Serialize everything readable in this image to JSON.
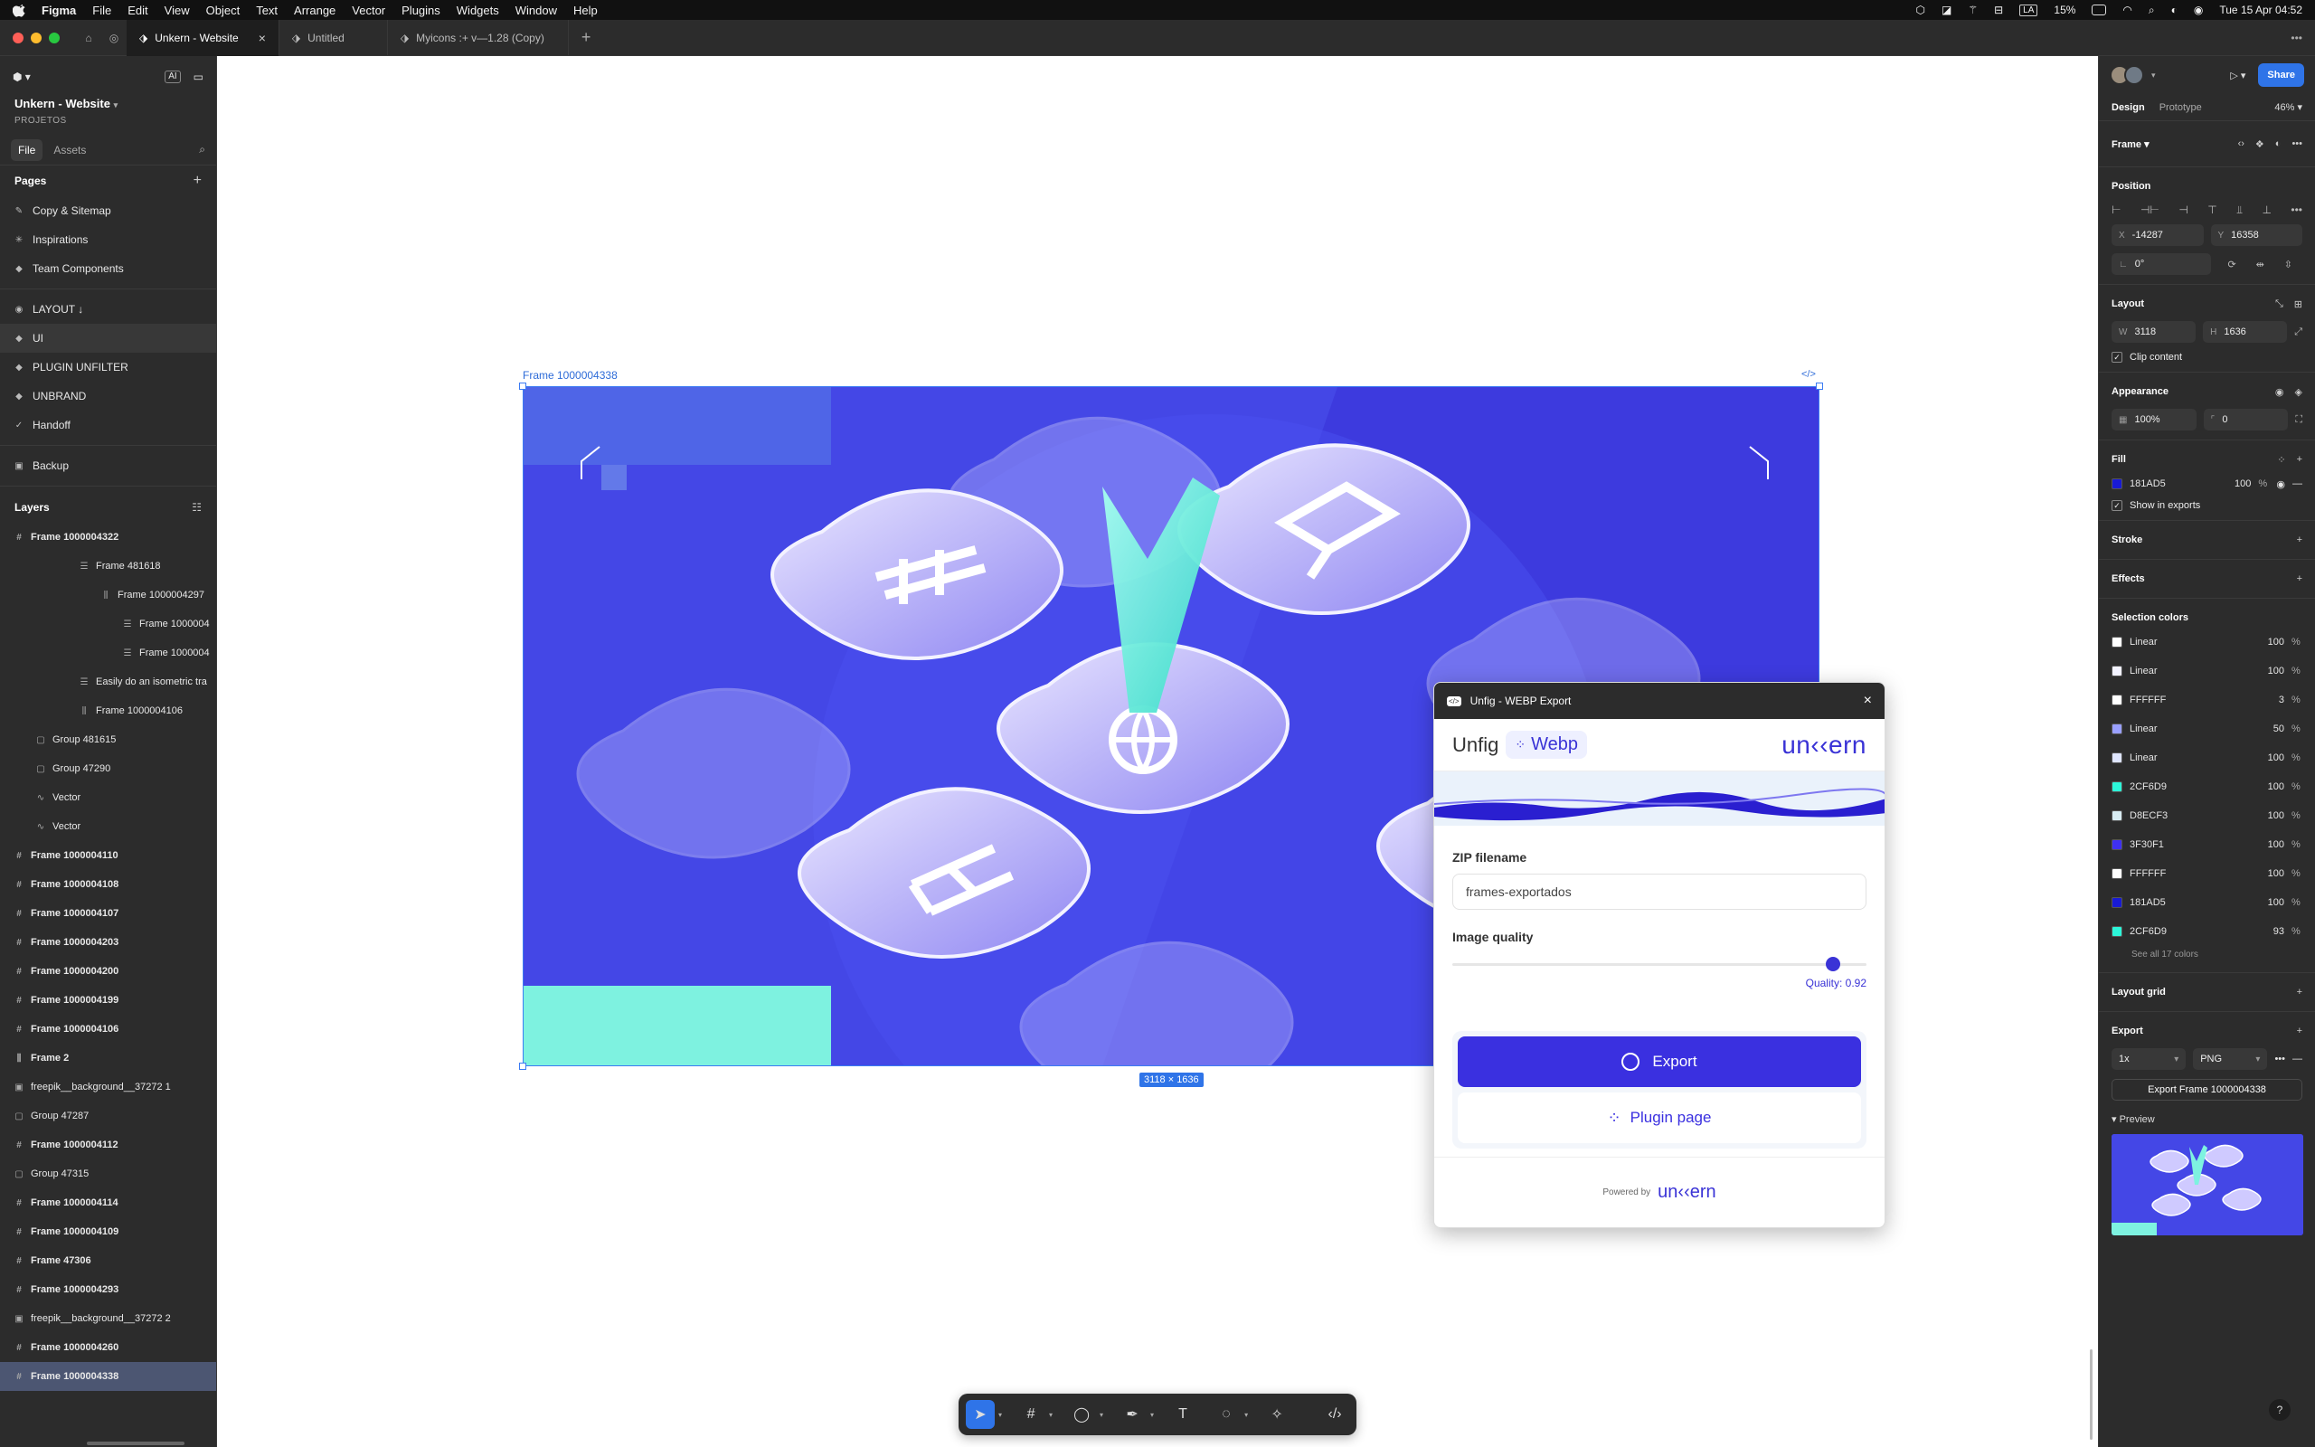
{
  "menubar": {
    "app": "Figma",
    "items": [
      "File",
      "Edit",
      "View",
      "Object",
      "Text",
      "Arrange",
      "Vector",
      "Plugins",
      "Widgets",
      "Window",
      "Help"
    ],
    "battery": "15%",
    "input_source": "LA",
    "datetime": "Tue 15 Apr 04:52"
  },
  "tabs": [
    {
      "label": "Unkern - Website",
      "active": true
    },
    {
      "label": "Untitled",
      "active": false
    },
    {
      "label": "Myicons :+ v—1.28 (Copy)",
      "active": false
    }
  ],
  "left": {
    "project_name": "Unkern - Website",
    "team": "PROJETOS",
    "file_tab": "File",
    "assets_tab": "Assets",
    "pages_heading": "Pages",
    "pages": [
      {
        "label": "Copy & Sitemap",
        "icon": "✎"
      },
      {
        "label": "Inspirations",
        "icon": "✳"
      },
      {
        "label": "Team Components",
        "icon": "◆"
      }
    ],
    "pages2": [
      {
        "label": "LAYOUT ↓",
        "icon": "◉"
      },
      {
        "label": "UI",
        "icon": "◆",
        "selected": true
      },
      {
        "label": "PLUGIN UNFILTER",
        "icon": "◆"
      },
      {
        "label": "UNBRAND",
        "icon": "◆"
      },
      {
        "label": "Handoff",
        "icon": "✓"
      }
    ],
    "backup": {
      "label": "Backup",
      "icon": "▣"
    },
    "layers_heading": "Layers",
    "layers": [
      {
        "label": "Frame 1000004322",
        "indent": 0,
        "bold": true,
        "icon": "#"
      },
      {
        "label": "Frame 481618",
        "indent": 3,
        "bold": false,
        "icon": "☰"
      },
      {
        "label": "Frame 1000004297",
        "indent": 4,
        "bold": false,
        "icon": "⫼"
      },
      {
        "label": "Frame 1000004",
        "indent": 5,
        "bold": false,
        "icon": "☰"
      },
      {
        "label": "Frame 1000004",
        "indent": 5,
        "bold": false,
        "icon": "☰"
      },
      {
        "label": "Easily do an isometric tra",
        "indent": 3,
        "bold": false,
        "icon": "☰"
      },
      {
        "label": "Frame 1000004106",
        "indent": 3,
        "bold": false,
        "icon": "⫼"
      },
      {
        "label": "Group 481615",
        "indent": 1,
        "bold": false,
        "icon": "▢"
      },
      {
        "label": "Group 47290",
        "indent": 1,
        "bold": false,
        "icon": "▢"
      },
      {
        "label": "Vector",
        "indent": 1,
        "bold": false,
        "icon": "∿"
      },
      {
        "label": "Vector",
        "indent": 1,
        "bold": false,
        "icon": "∿"
      },
      {
        "label": "Frame 1000004110",
        "indent": 0,
        "bold": true,
        "icon": "#"
      },
      {
        "label": "Frame 1000004108",
        "indent": 0,
        "bold": true,
        "icon": "#"
      },
      {
        "label": "Frame 1000004107",
        "indent": 0,
        "bold": true,
        "icon": "#"
      },
      {
        "label": "Frame 1000004203",
        "indent": 0,
        "bold": true,
        "icon": "#"
      },
      {
        "label": "Frame 1000004200",
        "indent": 0,
        "bold": true,
        "icon": "#"
      },
      {
        "label": "Frame 1000004199",
        "indent": 0,
        "bold": true,
        "icon": "#"
      },
      {
        "label": "Frame 1000004106",
        "indent": 0,
        "bold": true,
        "icon": "#"
      },
      {
        "label": "Frame 2",
        "indent": 0,
        "bold": true,
        "icon": "⫼"
      },
      {
        "label": "freepik__background__37272 1",
        "indent": 0,
        "bold": false,
        "icon": "▣"
      },
      {
        "label": "Group 47287",
        "indent": 0,
        "bold": false,
        "icon": "▢"
      },
      {
        "label": "Frame 1000004112",
        "indent": 0,
        "bold": true,
        "icon": "#"
      },
      {
        "label": "Group 47315",
        "indent": 0,
        "bold": false,
        "icon": "▢"
      },
      {
        "label": "Frame 1000004114",
        "indent": 0,
        "bold": true,
        "icon": "#"
      },
      {
        "label": "Frame 1000004109",
        "indent": 0,
        "bold": true,
        "icon": "#"
      },
      {
        "label": "Frame 47306",
        "indent": 0,
        "bold": true,
        "icon": "#"
      },
      {
        "label": "Frame 1000004293",
        "indent": 0,
        "bold": true,
        "icon": "#"
      },
      {
        "label": "freepik__background__37272 2",
        "indent": 0,
        "bold": false,
        "icon": "▣"
      },
      {
        "label": "Frame 1000004260",
        "indent": 0,
        "bold": true,
        "icon": "#"
      },
      {
        "label": "Frame 1000004338",
        "indent": 0,
        "bold": true,
        "icon": "#",
        "selected": true
      }
    ]
  },
  "canvas": {
    "frame_label": "Frame 1000004338",
    "frame_code": "</>",
    "dims_label": "3118 × 1636",
    "frame_bg": "#181AD5",
    "accent": "#2CF6D9"
  },
  "plugin": {
    "title": "Unfig - WEBP Export",
    "brand_unfig": "Unfig",
    "brand_webp": "Webp",
    "brand_logo": "un‹‹ern",
    "zip_label": "ZIP filename",
    "zip_value": "frames-exportados",
    "quality_label": "Image quality",
    "quality_value": 0.92,
    "quality_text": "Quality: 0.92",
    "export_label": "Export",
    "plugin_page_label": "Plugin page",
    "powered_by": "Powered by",
    "powered_logo": "un‹‹ern"
  },
  "right": {
    "tab_design": "Design",
    "tab_prototype": "Prototype",
    "zoom": "46%",
    "share_label": "Share",
    "node_type": "Frame",
    "position_heading": "Position",
    "x": "-14287",
    "y": "16358",
    "rotation": "0°",
    "layout_heading": "Layout",
    "w": "3118",
    "h": "1636",
    "clip_content": "Clip content",
    "appearance_heading": "Appearance",
    "opacity": "100%",
    "corner_radius": "0",
    "fill_heading": "Fill",
    "fill": {
      "hex": "181AD5",
      "opacity": "100",
      "unit": "%"
    },
    "show_in_exports": "Show in exports",
    "stroke_heading": "Stroke",
    "effects_heading": "Effects",
    "selection_colors_heading": "Selection colors",
    "selection_colors": [
      {
        "label": "Linear",
        "opacity": "100",
        "color": "#ffffff"
      },
      {
        "label": "Linear",
        "opacity": "100",
        "color": "#f2f2ff"
      },
      {
        "label": "FFFFFF",
        "opacity": "3",
        "color": "#FFFFFF"
      },
      {
        "label": "Linear",
        "opacity": "50",
        "color": "#9aa0ff"
      },
      {
        "label": "Linear",
        "opacity": "100",
        "color": "#dfe6ff"
      },
      {
        "label": "2CF6D9",
        "opacity": "100",
        "color": "#2CF6D9"
      },
      {
        "label": "D8ECF3",
        "opacity": "100",
        "color": "#D8ECF3"
      },
      {
        "label": "3F30F1",
        "opacity": "100",
        "color": "#3F30F1"
      },
      {
        "label": "FFFFFF",
        "opacity": "100",
        "color": "#FFFFFF"
      },
      {
        "label": "181AD5",
        "opacity": "100",
        "color": "#181AD5"
      },
      {
        "label": "2CF6D9",
        "opacity": "93",
        "color": "#2CF6D9"
      }
    ],
    "see_all": "See all 17 colors",
    "layout_grid_heading": "Layout grid",
    "export_heading": "Export",
    "export_scale": "1x",
    "export_format": "PNG",
    "export_button": "Export Frame 1000004338",
    "preview_label": "Preview"
  },
  "help": "?"
}
